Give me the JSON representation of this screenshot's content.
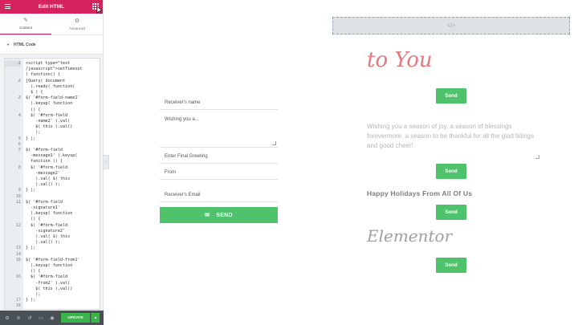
{
  "panel": {
    "title": "Edit HTML",
    "tabs": [
      {
        "label": "Content",
        "icon": "pencil-icon",
        "active": true
      },
      {
        "label": "Advanced",
        "icon": "gear-icon",
        "active": false
      }
    ],
    "section_title": "HTML Code",
    "code_lines": [
      {
        "num": "1",
        "fold": true,
        "text": "<script type=\"text",
        "active": true
      },
      {
        "num": "",
        "fold": false,
        "text": "/javascript\">setTimeout"
      },
      {
        "num": "",
        "fold": false,
        "text": "( function() {"
      },
      {
        "num": "2",
        "fold": true,
        "text": "jQuery( document"
      },
      {
        "num": "",
        "fold": false,
        "text": "  ).ready( function("
      },
      {
        "num": "",
        "fold": false,
        "text": "  $ ) {"
      },
      {
        "num": "3",
        "fold": true,
        "text": "$( '#form-field-name1'"
      },
      {
        "num": "",
        "fold": false,
        "text": "  ).keyup( function"
      },
      {
        "num": "",
        "fold": false,
        "text": "  () {"
      },
      {
        "num": "4",
        "fold": false,
        "text": "  $( '#form-field"
      },
      {
        "num": "",
        "fold": false,
        "text": "    -name2' ).val("
      },
      {
        "num": "",
        "fold": false,
        "text": "    $( this ).val()"
      },
      {
        "num": "",
        "fold": false,
        "text": "    );"
      },
      {
        "num": "5",
        "fold": false,
        "text": "} );"
      },
      {
        "num": "6",
        "fold": false,
        "text": ""
      },
      {
        "num": "7",
        "fold": true,
        "text": "$( '#form-field"
      },
      {
        "num": "",
        "fold": false,
        "text": "  -message1' ).keyup("
      },
      {
        "num": "",
        "fold": false,
        "text": "  function () {"
      },
      {
        "num": "8",
        "fold": false,
        "text": "  $( '#form-field"
      },
      {
        "num": "",
        "fold": false,
        "text": "    -message2'"
      },
      {
        "num": "",
        "fold": false,
        "text": "    ).val( $( this"
      },
      {
        "num": "",
        "fold": false,
        "text": "    ).val() );"
      },
      {
        "num": "9",
        "fold": false,
        "text": "} );"
      },
      {
        "num": "10",
        "fold": false,
        "text": ""
      },
      {
        "num": "11",
        "fold": true,
        "text": "$( '#form-field"
      },
      {
        "num": "",
        "fold": false,
        "text": "  -signature1'"
      },
      {
        "num": "",
        "fold": false,
        "text": "  ).keyup( function"
      },
      {
        "num": "",
        "fold": false,
        "text": "  () {"
      },
      {
        "num": "12",
        "fold": false,
        "text": "  $( '#form-field"
      },
      {
        "num": "",
        "fold": false,
        "text": "    -signature2'"
      },
      {
        "num": "",
        "fold": false,
        "text": "    ).val( $( this"
      },
      {
        "num": "",
        "fold": false,
        "text": "    ).val() );"
      },
      {
        "num": "13",
        "fold": false,
        "text": "} );"
      },
      {
        "num": "14",
        "fold": false,
        "text": ""
      },
      {
        "num": "15",
        "fold": true,
        "text": "$( '#form-field-from1'"
      },
      {
        "num": "",
        "fold": false,
        "text": "  ).keyup( function"
      },
      {
        "num": "",
        "fold": false,
        "text": "  () {"
      },
      {
        "num": "16",
        "fold": false,
        "text": "  $( '#form-field"
      },
      {
        "num": "",
        "fold": false,
        "text": "    -from2' ).val("
      },
      {
        "num": "",
        "fold": false,
        "text": "    $( this ).val()"
      },
      {
        "num": "",
        "fold": false,
        "text": "    );"
      },
      {
        "num": "17",
        "fold": false,
        "text": "} );"
      },
      {
        "num": "18",
        "fold": false,
        "text": ""
      }
    ],
    "footer": {
      "icons": [
        "settings-icon",
        "layers-icon",
        "history-icon",
        "responsive-icon",
        "preview-icon"
      ],
      "update_label": "UPDATE"
    }
  },
  "form": {
    "fields": [
      {
        "placeholder": "Receiver's name",
        "type": "text"
      },
      {
        "placeholder": "Wishing you a...",
        "type": "textarea"
      },
      {
        "placeholder": "Enter Final Greeting",
        "type": "text"
      },
      {
        "placeholder": "From",
        "type": "text"
      },
      {
        "placeholder": "Receiver's Email",
        "type": "text"
      }
    ],
    "send_label": "SEND"
  },
  "preview": {
    "script_title": "to You",
    "blessing_text": "Wishing you a season of joy, a season of blessings forevermore, a season to be thankful for all the glad tidings and good cheer!",
    "happy_text": "Happy Holidays From All Of Us",
    "elementor_text": "Elementor",
    "send_label": "Send",
    "html_icon": "code-icon"
  },
  "colors": {
    "brand": "#d4235d",
    "send_green": "#4ec36b",
    "update_green": "#39b54a",
    "script_pink": "#e5787f"
  }
}
